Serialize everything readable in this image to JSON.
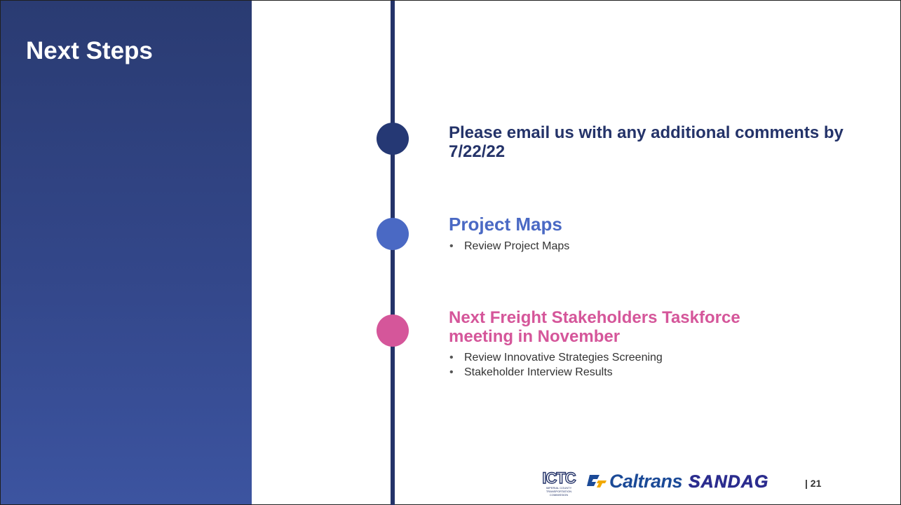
{
  "slide": {
    "title": "Next Steps",
    "page_number": "| 21"
  },
  "steps": [
    {
      "heading": "Please email us with any additional comments by 7/22/22",
      "bullets": []
    },
    {
      "heading": "Project Maps",
      "bullets": [
        "Review Project Maps"
      ]
    },
    {
      "heading": "Next Freight Stakeholders Taskforce meeting in November",
      "bullets": [
        "Review Innovative Strategies Screening",
        "Stakeholder Interview Results"
      ]
    }
  ],
  "logos": {
    "ictc": "ICTC",
    "ictc_sub": "IMPERIAL COUNTY TRANSPORTATION COMMISSION",
    "caltrans": "Caltrans",
    "sandag": "SANDAG"
  },
  "colors": {
    "sidebar": "#2a3b72",
    "timeline": "#243369",
    "step1": "#253874",
    "step2": "#4a69c4",
    "step3": "#d5569a"
  },
  "bullet_mark": "•"
}
